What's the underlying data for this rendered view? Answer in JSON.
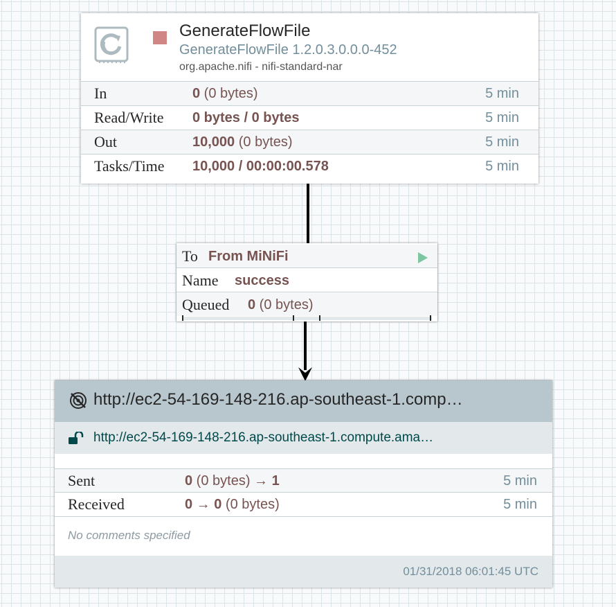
{
  "processor": {
    "name": "GenerateFlowFile",
    "type": "GenerateFlowFile 1.2.0.3.0.0.0-452",
    "bundle": "org.apache.nifi - nifi-standard-nar",
    "icon": "processor-icon",
    "status": "stopped",
    "status_color": "#d18686",
    "stats": [
      {
        "label": "In",
        "value_bold": "0",
        "value_rest": " (0 bytes)",
        "time": "5 min"
      },
      {
        "label": "Read/Write",
        "value_bold": "0 bytes / 0 bytes",
        "value_rest": "",
        "time": "5 min"
      },
      {
        "label": "Out",
        "value_bold": "10,000",
        "value_rest": " (0 bytes)",
        "time": "5 min"
      },
      {
        "label": "Tasks/Time",
        "value_bold": "10,000 / 00:00:00.578",
        "value_rest": "",
        "time": "5 min"
      }
    ]
  },
  "connection": {
    "to_label": "To",
    "to_value": "From MiNiFi",
    "name_label": "Name",
    "name_value": "success",
    "queued_label": "Queued",
    "queued_count": "0",
    "queued_size": " (0 bytes)",
    "port_status": "running",
    "port_status_color": "#7dc7a0"
  },
  "remote_group": {
    "title": "http://ec2-54-169-148-216.ap-southeast-1.comp…",
    "uri": "http://ec2-54-169-148-216.ap-southeast-1.compute.ama…",
    "sent": {
      "label": "Sent",
      "count": "0",
      "size": " (0 bytes)",
      "arrow": " → ",
      "ports": "1",
      "time": "5 min"
    },
    "received": {
      "label": "Received",
      "count": "0",
      "arrow": " → ",
      "ports": "0",
      "size": " (0 bytes)",
      "time": "5 min"
    },
    "comments": "No comments specified",
    "timestamp": "01/31/2018 06:01:45 UTC",
    "transmission_icon": "transmission-disabled-icon",
    "security_icon": "unlock-icon"
  },
  "colors": {
    "value": "#775351",
    "muted": "#728e9b",
    "header": "#b8c6cd",
    "uri": "#004849"
  }
}
